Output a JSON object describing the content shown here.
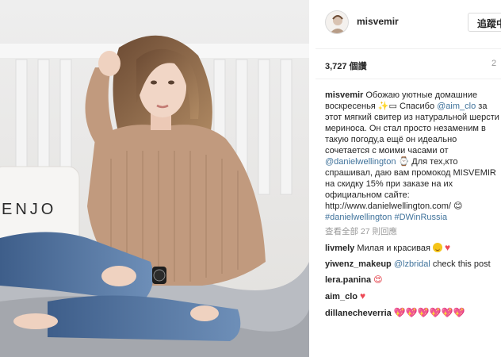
{
  "profile": {
    "username": "misvemir",
    "follow_label": "追蹤中"
  },
  "post": {
    "likes": "3,727 個讚",
    "time_ago": "2"
  },
  "caption": {
    "username": "misvemir",
    "text1": " Обожаю уютные домашние воскресенья ",
    "text2": " Спасибо ",
    "mention1": "@aim_clo",
    "text3": " за этот мягкий свитер из натуральной шерсти мериноса. Он стал просто незаменим в такую погоду,а ещё он идеально сочетается с моими часами от ",
    "mention2": "@danielwellington",
    "text4": " Для тех,кто спрашивал, даю вам промокод MISVEMIR на скидку 15% при заказе на их официальном сайте: http://www.danielwellington.com/ ",
    "hashtag1": "#danielwellington",
    "hashtag2": "#DWinRussia"
  },
  "view_all_comments": "查看全部 27 則回應",
  "comments": [
    {
      "username": "livmely",
      "text": " Милая и красивая "
    },
    {
      "username": "yiwenz_makeup",
      "mention": "@lzbridal",
      "text": " check this post"
    },
    {
      "username": "lera.panina",
      "text": " "
    },
    {
      "username": "aim_clo",
      "text": " "
    },
    {
      "username": "dillanecheverria",
      "text": " "
    }
  ],
  "photo_sign_text": "ENJO"
}
